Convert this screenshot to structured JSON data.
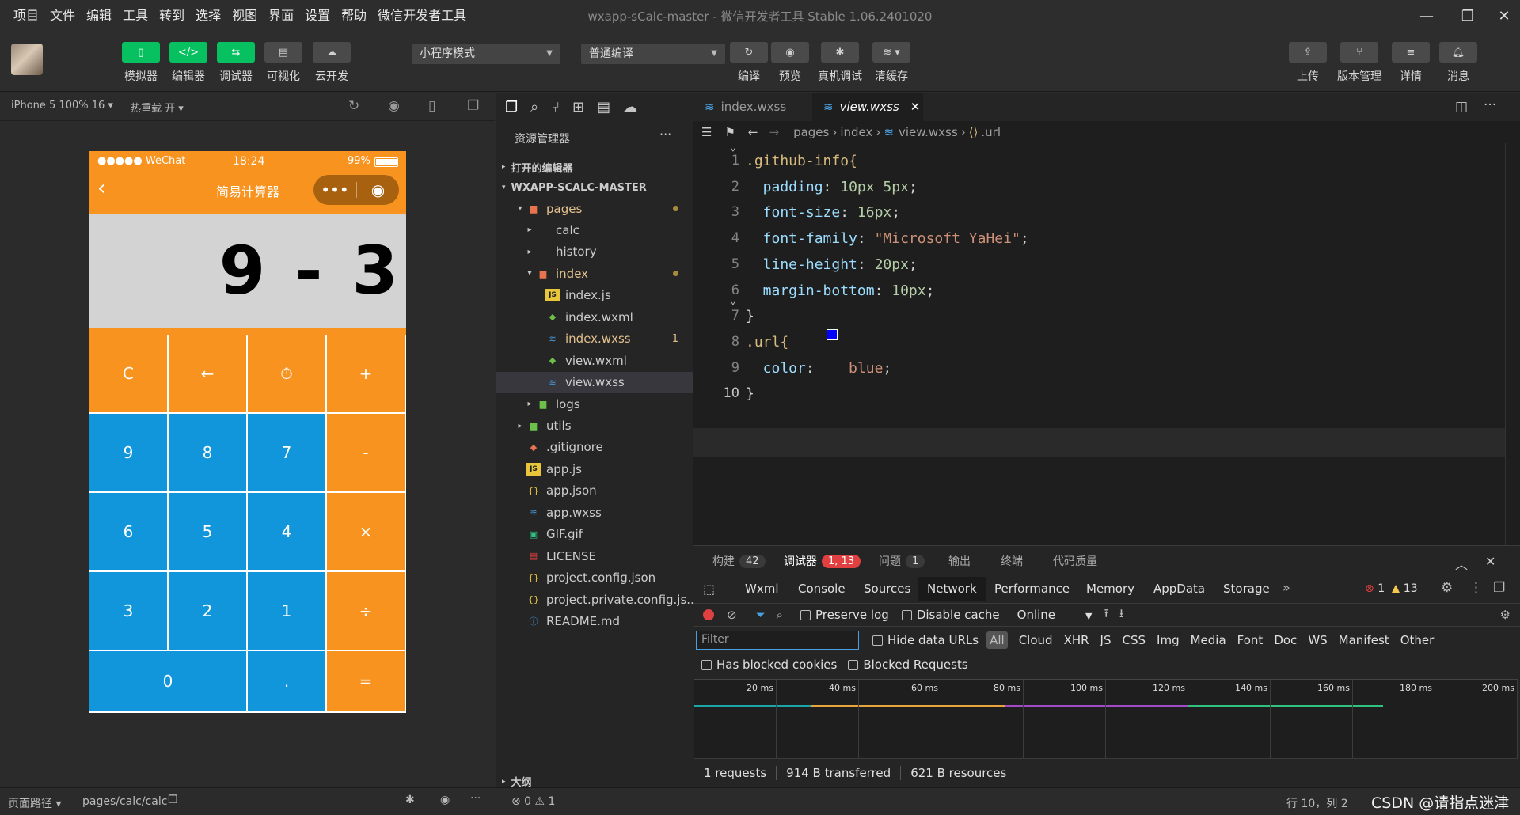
{
  "menu": [
    "项目",
    "文件",
    "编辑",
    "工具",
    "转到",
    "选择",
    "视图",
    "界面",
    "设置",
    "帮助",
    "微信开发者工具"
  ],
  "window_title": "wxapp-sCalc-master - 微信开发者工具 Stable 1.06.2401020",
  "toolbar": {
    "buttons": [
      {
        "label": "模拟器",
        "icon": "phone-icon"
      },
      {
        "label": "编辑器",
        "icon": "code-icon"
      },
      {
        "label": "调试器",
        "icon": "debug-icon"
      },
      {
        "label": "可视化",
        "icon": "layout-icon"
      },
      {
        "label": "云开发",
        "icon": "cloud-icon"
      }
    ],
    "mode_select": "小程序模式",
    "compile_select": "普通编译",
    "actions": [
      {
        "label": "编译",
        "icon": "refresh-icon"
      },
      {
        "label": "预览",
        "icon": "eye-icon"
      },
      {
        "label": "真机调试",
        "icon": "bug-icon"
      },
      {
        "label": "清缓存",
        "icon": "layers-icon"
      }
    ],
    "right_actions": [
      {
        "label": "上传",
        "icon": "upload-icon"
      },
      {
        "label": "版本管理",
        "icon": "branch-icon"
      },
      {
        "label": "详情",
        "icon": "menu-icon"
      },
      {
        "label": "消息",
        "icon": "bell-icon"
      }
    ]
  },
  "simulator": {
    "device": "iPhone 5 100% 16 ▾",
    "hot_reload": "热重载 开 ▾",
    "status_carrier": "●●●●● WeChat",
    "status_time": "18:24",
    "status_battery": "99%",
    "nav_title": "简易计算器",
    "display": "9 - 3",
    "keys": [
      [
        "C",
        "←",
        "⏱",
        "+"
      ],
      [
        "9",
        "8",
        "7",
        "-"
      ],
      [
        "6",
        "5",
        "4",
        "×"
      ],
      [
        "3",
        "2",
        "1",
        "÷"
      ],
      [
        "0",
        ".",
        "="
      ]
    ]
  },
  "explorer": {
    "title": "资源管理器",
    "open_editors": "打开的编辑器",
    "project": "WXAPP-SCALC-MASTER",
    "outline": "大纲",
    "tree": [
      {
        "name": "pages",
        "depth": 1,
        "type": "folder-open",
        "twisty": "▾",
        "color": "#e2c08d",
        "dot": true
      },
      {
        "name": "calc",
        "depth": 2,
        "type": "folder",
        "twisty": "▸",
        "color": "#cccccc"
      },
      {
        "name": "history",
        "depth": 2,
        "type": "folder",
        "twisty": "▸",
        "color": "#cccccc"
      },
      {
        "name": "index",
        "depth": 2,
        "type": "folder-open",
        "twisty": "▾",
        "color": "#e2c08d",
        "dot": true
      },
      {
        "name": "index.js",
        "depth": 3,
        "type": "js",
        "color": "#cccccc"
      },
      {
        "name": "index.wxml",
        "depth": 3,
        "type": "wxml",
        "color": "#cccccc"
      },
      {
        "name": "index.wxss",
        "depth": 3,
        "type": "wxss",
        "color": "#e2c08d",
        "badge": "1"
      },
      {
        "name": "view.wxml",
        "depth": 3,
        "type": "wxml",
        "color": "#cccccc"
      },
      {
        "name": "view.wxss",
        "depth": 3,
        "type": "wxss",
        "color": "#cccccc",
        "selected": true
      },
      {
        "name": "logs",
        "depth": 2,
        "type": "folder-green",
        "twisty": "▸",
        "color": "#cccccc"
      },
      {
        "name": "utils",
        "depth": 1,
        "type": "folder-green",
        "twisty": "▸",
        "color": "#cccccc"
      },
      {
        "name": ".gitignore",
        "depth": 1,
        "type": "git",
        "color": "#cccccc"
      },
      {
        "name": "app.js",
        "depth": 1,
        "type": "js",
        "color": "#cccccc"
      },
      {
        "name": "app.json",
        "depth": 1,
        "type": "json",
        "color": "#cccccc"
      },
      {
        "name": "app.wxss",
        "depth": 1,
        "type": "wxss",
        "color": "#cccccc"
      },
      {
        "name": "GIF.gif",
        "depth": 1,
        "type": "image",
        "color": "#cccccc"
      },
      {
        "name": "LICENSE",
        "depth": 1,
        "type": "license",
        "color": "#cccccc"
      },
      {
        "name": "project.config.json",
        "depth": 1,
        "type": "json",
        "color": "#cccccc"
      },
      {
        "name": "project.private.config.js...",
        "depth": 1,
        "type": "json",
        "color": "#cccccc"
      },
      {
        "name": "README.md",
        "depth": 1,
        "type": "info",
        "color": "#cccccc"
      }
    ]
  },
  "editor": {
    "tabs": [
      {
        "name": "index.wxss",
        "active": false
      },
      {
        "name": "view.wxss",
        "active": true
      }
    ],
    "breadcrumb": [
      "pages",
      "index",
      "view.wxss",
      ".url"
    ],
    "lines": [
      {
        "n": "1",
        "tokens": [
          {
            "t": ".github-info{",
            "c": "sel-kw"
          }
        ]
      },
      {
        "n": "2",
        "tokens": [
          {
            "t": "  padding",
            "c": "prop"
          },
          {
            "t": ": ",
            "c": "punct"
          },
          {
            "t": "10px 5px",
            "c": "num"
          },
          {
            "t": ";",
            "c": "punct"
          }
        ]
      },
      {
        "n": "3",
        "tokens": [
          {
            "t": "  font-size",
            "c": "prop"
          },
          {
            "t": ": ",
            "c": "punct"
          },
          {
            "t": "16px",
            "c": "num"
          },
          {
            "t": ";",
            "c": "punct"
          }
        ]
      },
      {
        "n": "4",
        "tokens": [
          {
            "t": "  font-family",
            "c": "prop"
          },
          {
            "t": ": ",
            "c": "punct"
          },
          {
            "t": "\"Microsoft YaHei\"",
            "c": "str"
          },
          {
            "t": ";",
            "c": "punct"
          }
        ]
      },
      {
        "n": "5",
        "tokens": [
          {
            "t": "  line-height",
            "c": "prop"
          },
          {
            "t": ": ",
            "c": "punct"
          },
          {
            "t": "20px",
            "c": "num"
          },
          {
            "t": ";",
            "c": "punct"
          }
        ]
      },
      {
        "n": "6",
        "tokens": [
          {
            "t": "  margin-bottom",
            "c": "prop"
          },
          {
            "t": ": ",
            "c": "punct"
          },
          {
            "t": "10px",
            "c": "num"
          },
          {
            "t": ";",
            "c": "punct"
          }
        ]
      },
      {
        "n": "7",
        "tokens": [
          {
            "t": "}",
            "c": "punct"
          }
        ]
      },
      {
        "n": "8",
        "tokens": [
          {
            "t": ".url{",
            "c": "sel-kw"
          }
        ]
      },
      {
        "n": "9",
        "tokens": [
          {
            "t": "  color",
            "c": "prop"
          },
          {
            "t": ": ",
            "c": "punct"
          },
          {
            "t": "   blue",
            "c": "val"
          },
          {
            "t": ";",
            "c": "punct"
          }
        ]
      },
      {
        "n": "10",
        "tokens": [
          {
            "t": "}",
            "c": "punct"
          }
        ]
      }
    ]
  },
  "panel": {
    "tabs": [
      {
        "label": "构建",
        "badge": "42"
      },
      {
        "label": "调试器",
        "badge": "1, 13",
        "active": true
      },
      {
        "label": "问题",
        "badge": "1"
      },
      {
        "label": "输出"
      },
      {
        "label": "终端"
      },
      {
        "label": "代码质量"
      }
    ],
    "devtabs": [
      "Wxml",
      "Console",
      "Sources",
      "Network",
      "Performance",
      "Memory",
      "AppData",
      "Storage"
    ],
    "active_devtab": "Network",
    "errors": "1",
    "warnings": "13",
    "preserve_log": "Preserve log",
    "disable_cache": "Disable cache",
    "throttle": "Online",
    "filter_placeholder": "Filter",
    "hide_data_urls": "Hide data URLs",
    "filter_types": [
      "All",
      "Cloud",
      "XHR",
      "JS",
      "CSS",
      "Img",
      "Media",
      "Font",
      "Doc",
      "WS",
      "Manifest",
      "Other"
    ],
    "has_blocked_cookies": "Has blocked cookies",
    "blocked_requests": "Blocked Requests",
    "ticks": [
      "20 ms",
      "40 ms",
      "60 ms",
      "80 ms",
      "100 ms",
      "120 ms",
      "140 ms",
      "160 ms",
      "180 ms",
      "200 ms"
    ],
    "summary": [
      "1 requests",
      "914 B transferred",
      "621 B resources"
    ]
  },
  "statusbar": {
    "page_path_label": "页面路径 ▾",
    "page_path": "pages/calc/calc",
    "problems": "⊗ 0 ⚠ 1",
    "cursor": "行 10，列 2",
    "watermark": "CSDN @请指点迷津"
  }
}
